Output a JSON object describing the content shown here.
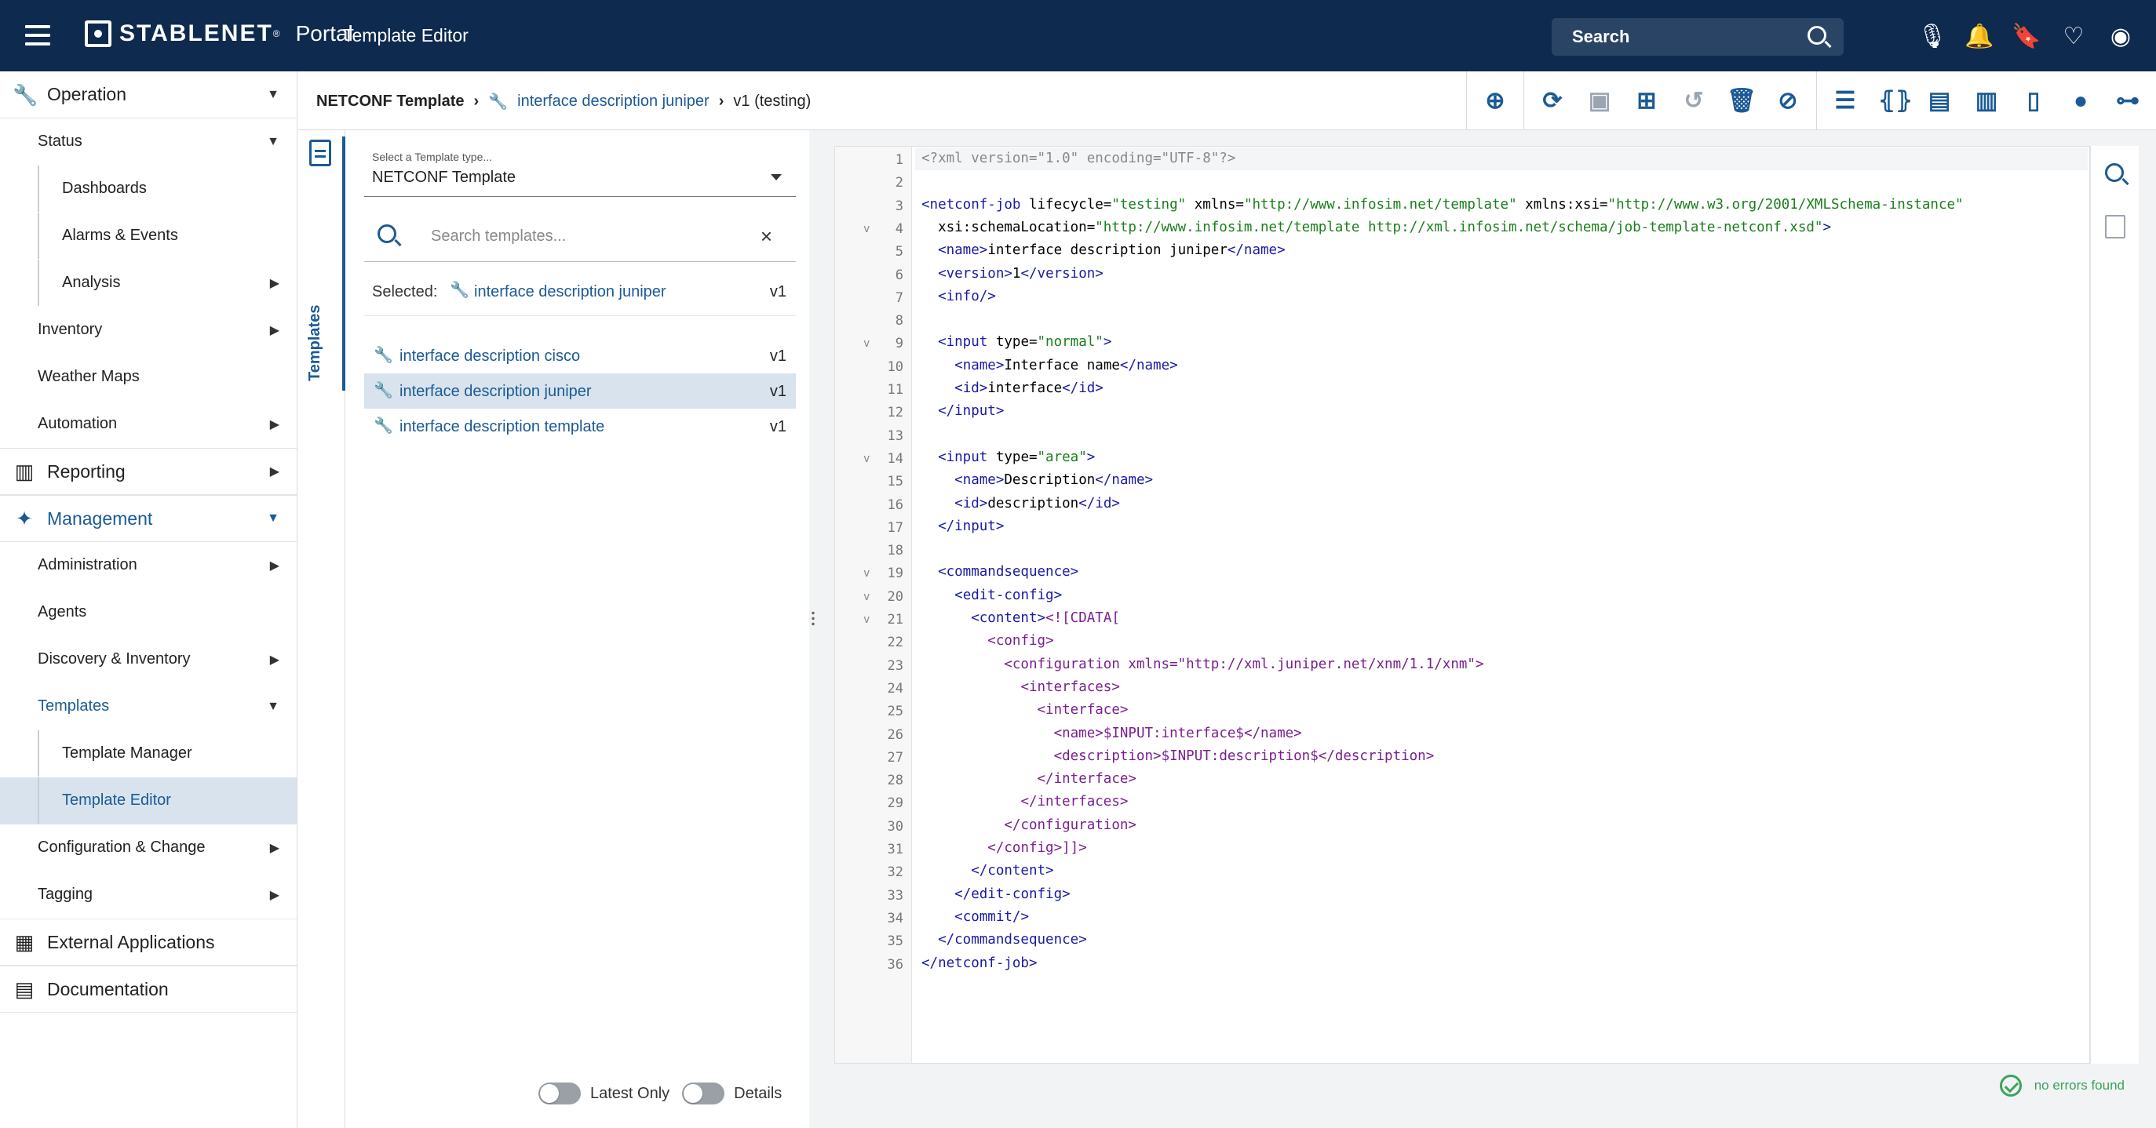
{
  "header": {
    "brand": "STABLENET",
    "brand_mark": "®",
    "portal": "Portal",
    "app_title": "Template Editor",
    "search_label": "Search",
    "icons": [
      "microphone-icon",
      "alarm-icon",
      "bookmark-icon",
      "health-icon",
      "user-icon"
    ]
  },
  "sidebar": {
    "items": [
      {
        "label": "Operation",
        "icon": "wrench-icon",
        "level": 0,
        "arrow": "down"
      },
      {
        "label": "Status",
        "level": 1,
        "arrow": "down"
      },
      {
        "label": "Dashboards",
        "level": 2
      },
      {
        "label": "Alarms & Events",
        "level": 2
      },
      {
        "label": "Analysis",
        "level": 2,
        "arrow": "right"
      },
      {
        "label": "Inventory",
        "level": 1,
        "arrow": "right"
      },
      {
        "label": "Weather Maps",
        "level": 1
      },
      {
        "label": "Automation",
        "level": 1,
        "arrow": "right"
      },
      {
        "label": "Reporting",
        "icon": "bar-chart-icon",
        "level": 0,
        "arrow": "right"
      },
      {
        "label": "Management",
        "icon": "management-icon",
        "level": 0,
        "arrow": "down",
        "active": true
      },
      {
        "label": "Administration",
        "level": 1,
        "arrow": "right"
      },
      {
        "label": "Agents",
        "level": 1
      },
      {
        "label": "Discovery & Inventory",
        "level": 1,
        "arrow": "right"
      },
      {
        "label": "Templates",
        "level": 1,
        "arrow": "down",
        "active": true
      },
      {
        "label": "Template Manager",
        "level": 2
      },
      {
        "label": "Template Editor",
        "level": 2,
        "selected": true
      },
      {
        "label": "Configuration & Change",
        "level": 1,
        "arrow": "right"
      },
      {
        "label": "Tagging",
        "level": 1,
        "arrow": "right"
      },
      {
        "label": "External Applications",
        "icon": "apps-grid-icon",
        "level": 0
      },
      {
        "label": "Documentation",
        "icon": "documentation-icon",
        "level": 0
      }
    ]
  },
  "breadcrumb": {
    "root": "NETCONF Template",
    "template": "interface description juniper",
    "version": "v1 (testing)"
  },
  "toolbar": {
    "groups": [
      [
        "add-icon"
      ],
      [
        "reload-icon",
        "save-icon",
        "save-as-icon",
        "revert-icon",
        "delete-icon",
        "disable-icon"
      ],
      [
        "format-icon",
        "variables-icon",
        "translate-a-icon",
        "translate-b-icon",
        "book-icon",
        "hint-icon",
        "hierarchy-icon"
      ]
    ]
  },
  "templates_panel": {
    "tab_label": "Templates",
    "type_label": "Select a Template type...",
    "type_value": "NETCONF Template",
    "search_placeholder": "Search templates...",
    "selected_label": "Selected:",
    "selected_name": "interface description juniper",
    "selected_version": "v1",
    "list": [
      {
        "name": "interface description cisco",
        "version": "v1"
      },
      {
        "name": "interface description juniper",
        "version": "v1",
        "selected": true
      },
      {
        "name": "interface description template",
        "version": "v1"
      }
    ],
    "toggle_latest": "Latest Only",
    "toggle_details": "Details"
  },
  "editor": {
    "status": "no errors found",
    "lines": [
      "<?xml version=\"1.0\" encoding=\"UTF-8\"?>",
      "",
      "<netconf-job lifecycle=\"testing\" xmlns=\"http://www.infosim.net/template\" xmlns:xsi=\"http://www.w3.org/2001/XMLSchema-instance\"",
      "  xsi:schemaLocation=\"http://www.infosim.net/template http://xml.infosim.net/schema/job-template-netconf.xsd\">",
      "  <name>interface description juniper</name>",
      "  <version>1</version>",
      "  <info/>",
      "",
      "  <input type=\"normal\">",
      "    <name>Interface name</name>",
      "    <id>interface</id>",
      "  </input>",
      "",
      "  <input type=\"area\">",
      "    <name>Description</name>",
      "    <id>description</id>",
      "  </input>",
      "",
      "  <commandsequence>",
      "    <edit-config>",
      "      <content><![CDATA[",
      "        <config>",
      "          <configuration xmlns=\"http://xml.juniper.net/xnm/1.1/xnm\">",
      "            <interfaces>",
      "              <interface>",
      "                <name>$INPUT:interface$</name>",
      "                <description>$INPUT:description$</description>",
      "              </interface>",
      "            </interfaces>",
      "          </configuration>",
      "        </config>]]>",
      "      </content>",
      "    </edit-config>",
      "    <commit/>",
      "  </commandsequence>",
      "</netconf-job>"
    ],
    "fold_lines": [
      4,
      9,
      14,
      19,
      20,
      21
    ],
    "cdata_from": 21,
    "cdata_to": 31
  }
}
